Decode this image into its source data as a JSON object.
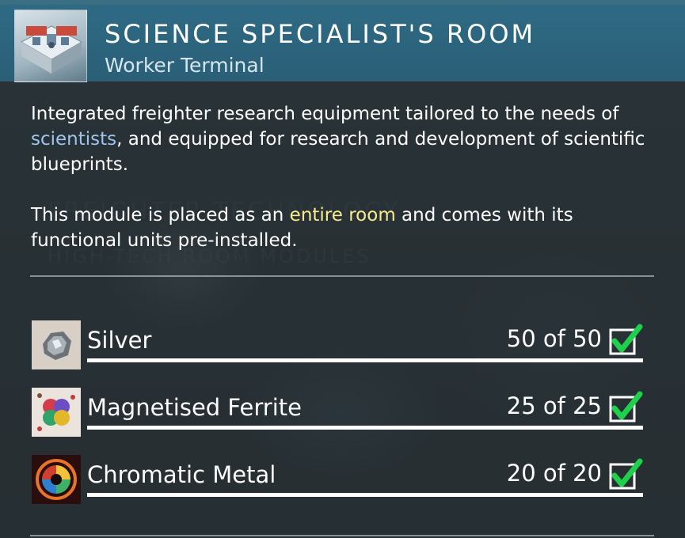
{
  "header": {
    "title": "SCIENCE SPECIALIST'S ROOM",
    "subtitle": "Worker Terminal",
    "thumbnail_icon": "science-room-icon"
  },
  "description": {
    "p1_a": "Integrated freighter research equipment tailored to the needs of ",
    "p1_kw": "scientists",
    "p1_b": ", and equipped for research and development of scientific blueprints.",
    "p2_a": "This module is placed as an ",
    "p2_kw": "entire room",
    "p2_b": " and comes with its functional units pre-installed."
  },
  "resources": [
    {
      "name": "Silver",
      "count": "50 of 50",
      "icon": "silver-icon",
      "complete": 1.0
    },
    {
      "name": "Magnetised Ferrite",
      "count": "25 of 25",
      "icon": "magnetised-ferrite-icon",
      "complete": 1.0
    },
    {
      "name": "Chromatic Metal",
      "count": "20 of 20",
      "icon": "chromatic-metal-icon",
      "complete": 1.0
    }
  ],
  "colors": {
    "header_bg": "#2f6a84",
    "highlight_blue": "#9cc4ee",
    "highlight_yellow": "#f7eb8c",
    "check_green": "#1fd04a"
  }
}
